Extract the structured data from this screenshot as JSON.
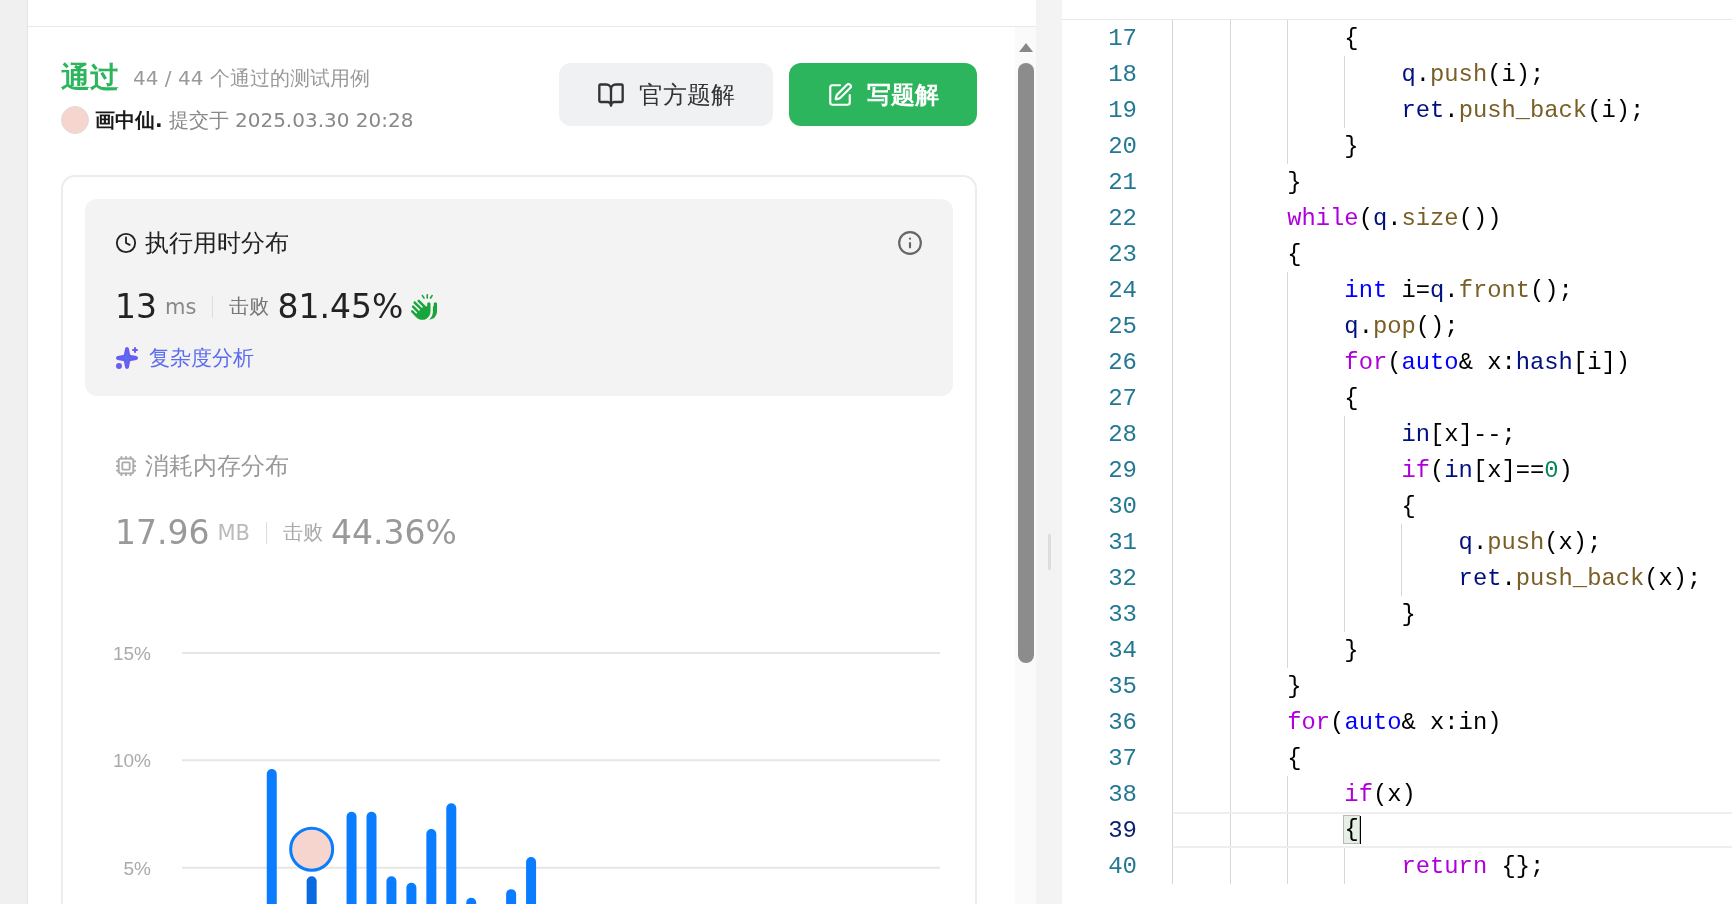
{
  "submission": {
    "status": "通过",
    "cases": "44 / 44 个通过的测试用例",
    "author": "画中仙.",
    "submitted": "提交于 2025.03.30 20:28"
  },
  "buttons": [
    {
      "kind": "secondary",
      "label": "官方题解"
    },
    {
      "kind": "primary",
      "label": "写题解"
    }
  ],
  "runtime": {
    "title": "执行用时分布",
    "value": "13",
    "unit": "ms",
    "beats_label": "击败",
    "beats": "81.45%",
    "analysis": "复杂度分析"
  },
  "memory": {
    "title": "消耗内存分布",
    "value": "17.96",
    "unit": "MB",
    "beats_label": "击败",
    "beats": "44.36%",
    "chart_data": {
      "type": "bar",
      "ylim": [
        0,
        15
      ],
      "yticks": [
        {
          "value": 5,
          "label": "5%"
        },
        {
          "value": 10,
          "label": "10%"
        },
        {
          "value": 15,
          "label": "15%"
        }
      ],
      "series": [
        {
          "color": "#0a7cff",
          "values": [
            null,
            null,
            null,
            null,
            9.6,
            null,
            null,
            null,
            7.6,
            7.6,
            4.6,
            4.3,
            6.8,
            8.0,
            3.6,
            null,
            4.0,
            5.5,
            null,
            null,
            null,
            null,
            null,
            null,
            null,
            null,
            null,
            null,
            null,
            null,
            null,
            null,
            null,
            null,
            null,
            null,
            null,
            null
          ]
        },
        {
          "color": "#0a6be0",
          "values": [
            null,
            null,
            null,
            null,
            null,
            null,
            4.6,
            null,
            null,
            null,
            null,
            null,
            null,
            null,
            null,
            null,
            null,
            null,
            null,
            null,
            null,
            null,
            null,
            null,
            null,
            null,
            null,
            null,
            null,
            null,
            null,
            null,
            null,
            null,
            null,
            null,
            null,
            null
          ]
        }
      ]
    }
  },
  "code": {
    "lines": [
      {
        "number": "17",
        "current": false,
        "tokens": [
          {
            "kind": "plain",
            "text": "            {"
          }
        ]
      },
      {
        "number": "18",
        "current": false,
        "tokens": [
          {
            "kind": "var",
            "text": "                q"
          },
          {
            "kind": "plain",
            "text": "."
          },
          {
            "kind": "func",
            "text": "push"
          },
          {
            "kind": "plain",
            "text": "(i);"
          }
        ]
      },
      {
        "number": "19",
        "current": false,
        "tokens": [
          {
            "kind": "var",
            "text": "                ret"
          },
          {
            "kind": "plain",
            "text": "."
          },
          {
            "kind": "func",
            "text": "push_back"
          },
          {
            "kind": "plain",
            "text": "(i);"
          }
        ]
      },
      {
        "number": "20",
        "current": false,
        "tokens": [
          {
            "kind": "plain",
            "text": "            }"
          }
        ]
      },
      {
        "number": "21",
        "current": false,
        "tokens": [
          {
            "kind": "plain",
            "text": "        }"
          }
        ]
      },
      {
        "number": "22",
        "current": false,
        "tokens": [
          {
            "kind": "keyword",
            "text": "        while"
          },
          {
            "kind": "plain",
            "text": "("
          },
          {
            "kind": "var",
            "text": "q"
          },
          {
            "kind": "plain",
            "text": "."
          },
          {
            "kind": "func",
            "text": "size"
          },
          {
            "kind": "plain",
            "text": "())"
          }
        ]
      },
      {
        "number": "23",
        "current": false,
        "tokens": [
          {
            "kind": "plain",
            "text": "        {"
          }
        ]
      },
      {
        "number": "24",
        "current": false,
        "tokens": [
          {
            "kind": "type",
            "text": "            int"
          },
          {
            "kind": "plain",
            "text": " i="
          },
          {
            "kind": "var",
            "text": "q"
          },
          {
            "kind": "plain",
            "text": "."
          },
          {
            "kind": "func",
            "text": "front"
          },
          {
            "kind": "plain",
            "text": "();"
          }
        ]
      },
      {
        "number": "25",
        "current": false,
        "tokens": [
          {
            "kind": "var",
            "text": "            q"
          },
          {
            "kind": "plain",
            "text": "."
          },
          {
            "kind": "func",
            "text": "pop"
          },
          {
            "kind": "plain",
            "text": "();"
          }
        ]
      },
      {
        "number": "26",
        "current": false,
        "tokens": [
          {
            "kind": "keyword",
            "text": "            for"
          },
          {
            "kind": "plain",
            "text": "("
          },
          {
            "kind": "type",
            "text": "auto"
          },
          {
            "kind": "plain",
            "text": "& x:"
          },
          {
            "kind": "var",
            "text": "hash"
          },
          {
            "kind": "plain",
            "text": "[i])"
          }
        ]
      },
      {
        "number": "27",
        "current": false,
        "tokens": [
          {
            "kind": "plain",
            "text": "            {"
          }
        ]
      },
      {
        "number": "28",
        "current": false,
        "tokens": [
          {
            "kind": "var",
            "text": "                in"
          },
          {
            "kind": "plain",
            "text": "[x]--;"
          }
        ]
      },
      {
        "number": "29",
        "current": false,
        "tokens": [
          {
            "kind": "keyword",
            "text": "                if"
          },
          {
            "kind": "plain",
            "text": "("
          },
          {
            "kind": "var",
            "text": "in"
          },
          {
            "kind": "plain",
            "text": "[x]=="
          },
          {
            "kind": "number",
            "text": "0"
          },
          {
            "kind": "plain",
            "text": ")"
          }
        ]
      },
      {
        "number": "30",
        "current": false,
        "tokens": [
          {
            "kind": "plain",
            "text": "                {"
          }
        ]
      },
      {
        "number": "31",
        "current": false,
        "tokens": [
          {
            "kind": "var",
            "text": "                    q"
          },
          {
            "kind": "plain",
            "text": "."
          },
          {
            "kind": "func",
            "text": "push"
          },
          {
            "kind": "plain",
            "text": "(x);"
          }
        ]
      },
      {
        "number": "32",
        "current": false,
        "tokens": [
          {
            "kind": "var",
            "text": "                    ret"
          },
          {
            "kind": "plain",
            "text": "."
          },
          {
            "kind": "func",
            "text": "push_back"
          },
          {
            "kind": "plain",
            "text": "(x);"
          }
        ]
      },
      {
        "number": "33",
        "current": false,
        "tokens": [
          {
            "kind": "plain",
            "text": "                }"
          }
        ]
      },
      {
        "number": "34",
        "current": false,
        "tokens": [
          {
            "kind": "plain",
            "text": "            }"
          }
        ]
      },
      {
        "number": "35",
        "current": false,
        "tokens": [
          {
            "kind": "plain",
            "text": "        }"
          }
        ]
      },
      {
        "number": "36",
        "current": false,
        "tokens": [
          {
            "kind": "keyword",
            "text": "        for"
          },
          {
            "kind": "plain",
            "text": "("
          },
          {
            "kind": "type",
            "text": "auto"
          },
          {
            "kind": "plain",
            "text": "& x:in)"
          }
        ]
      },
      {
        "number": "37",
        "current": false,
        "tokens": [
          {
            "kind": "plain",
            "text": "        {"
          }
        ]
      },
      {
        "number": "38",
        "current": false,
        "tokens": [
          {
            "kind": "keyword",
            "text": "            if"
          },
          {
            "kind": "plain",
            "text": "(x)"
          }
        ]
      },
      {
        "number": "39",
        "current": true,
        "tokens": [
          {
            "kind": "bracket",
            "text": "            {"
          }
        ]
      },
      {
        "number": "40",
        "current": false,
        "tokens": [
          {
            "kind": "keyword",
            "text": "                return"
          },
          {
            "kind": "plain",
            "text": " {};"
          }
        ]
      }
    ]
  }
}
